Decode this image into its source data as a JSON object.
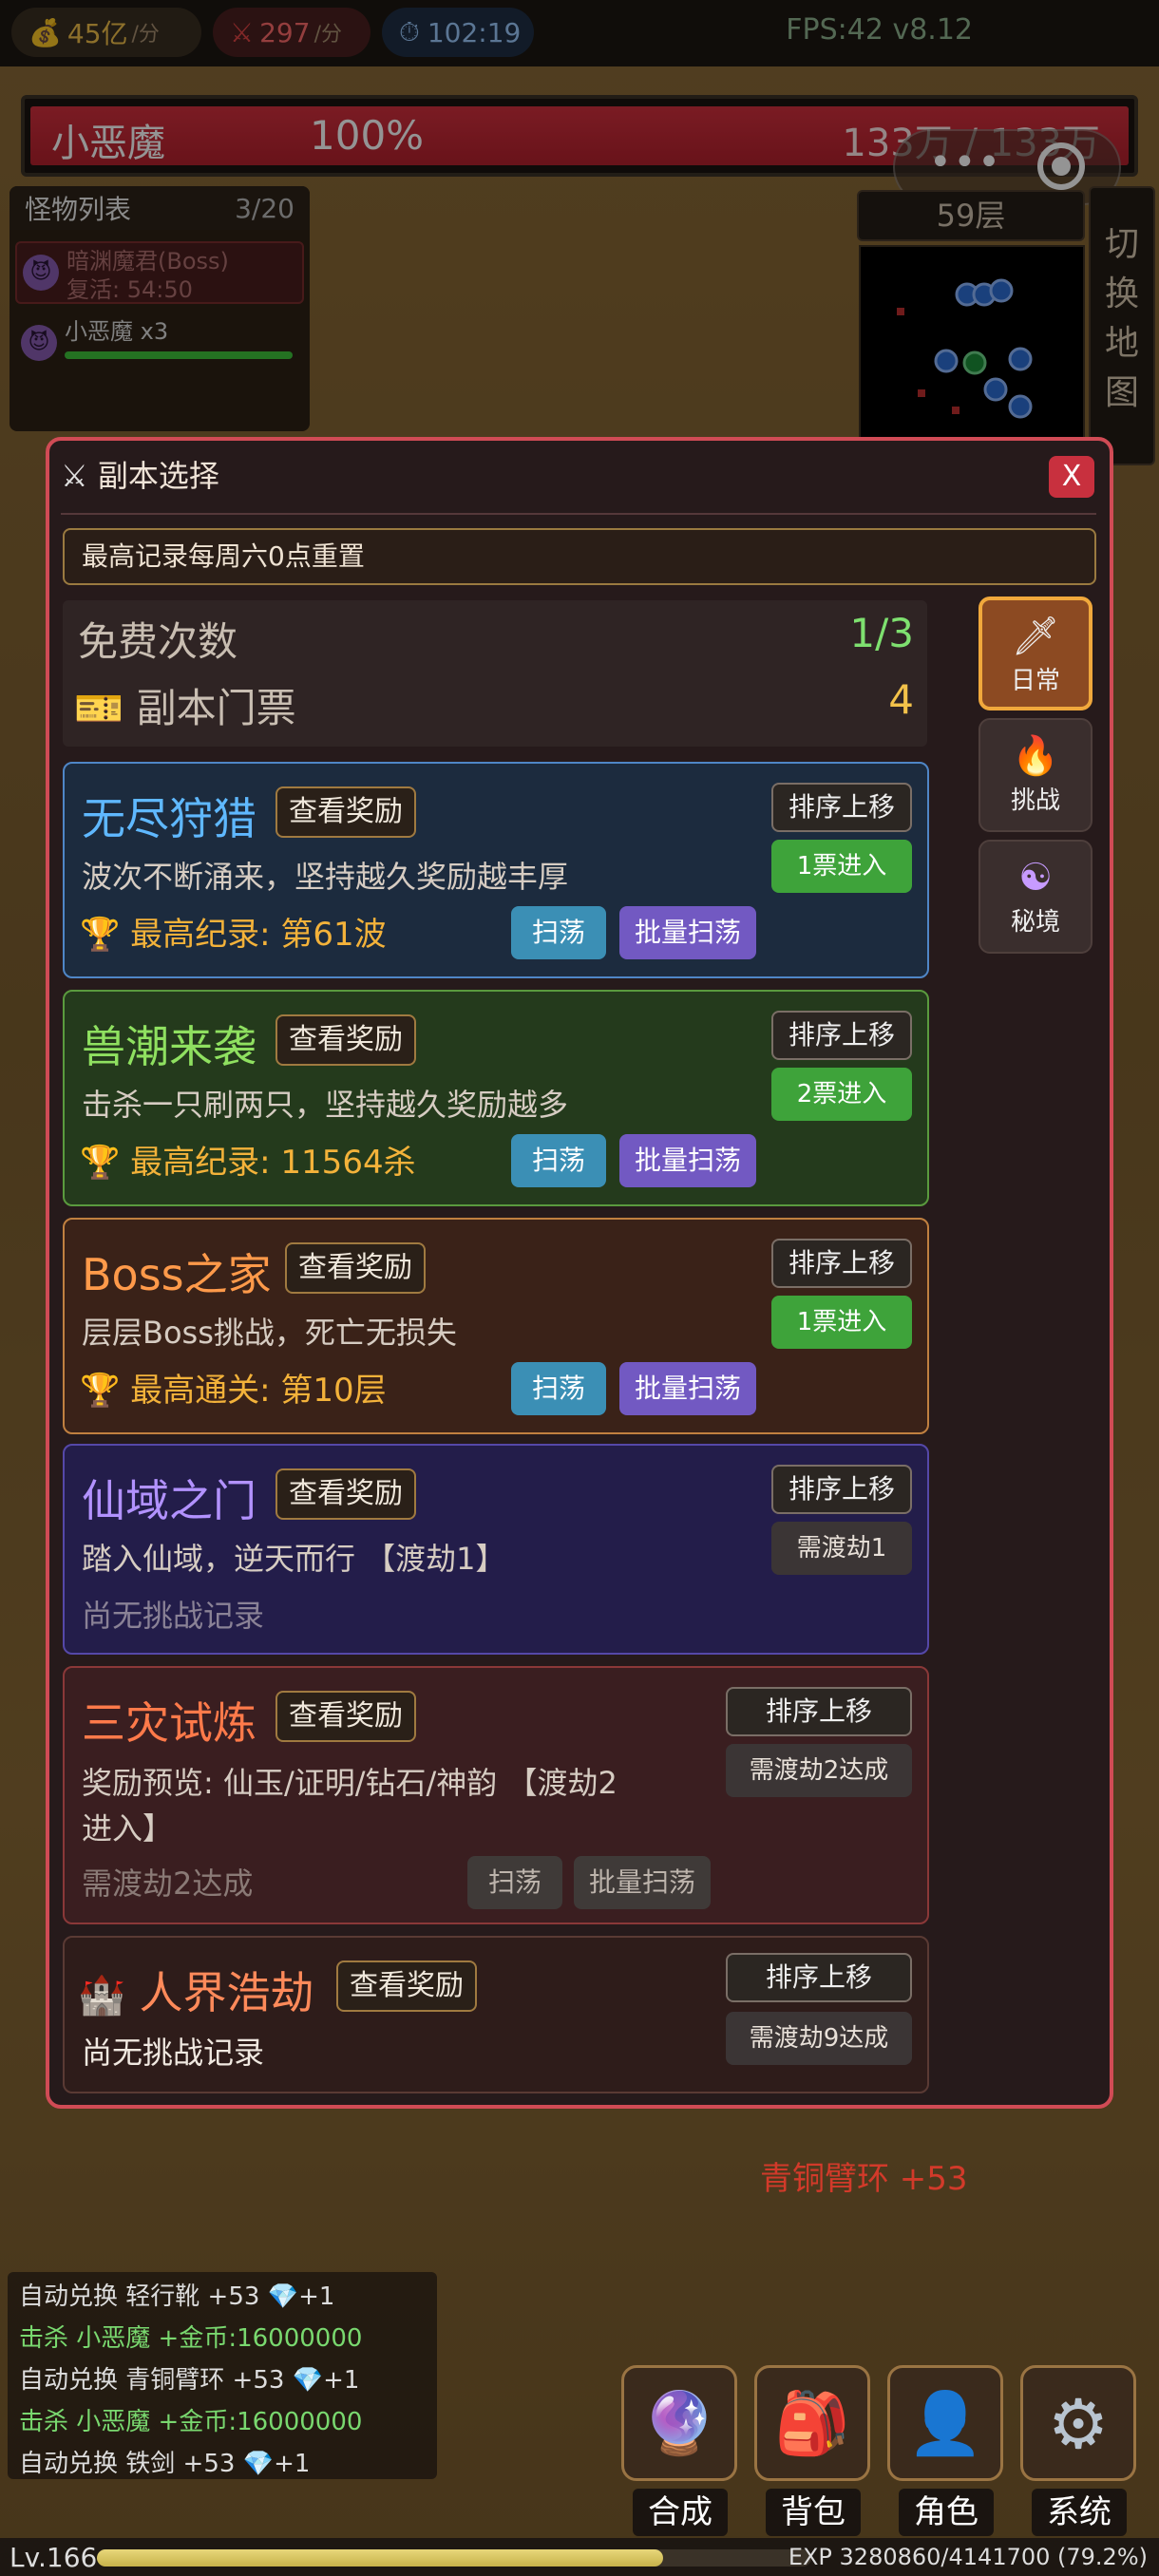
{
  "topbar": {
    "gold": "45亿",
    "gold_unit": "/分",
    "kills": "297",
    "kills_unit": "/分",
    "timer": "102:19",
    "fps": "FPS:42 v8.12"
  },
  "boss": {
    "name": "小恶魔",
    "percent": "100%",
    "hp": "133万 / 133万",
    "hp_fraction": 1.0
  },
  "monster_list": {
    "title": "怪物列表",
    "count": "3/20",
    "items": [
      {
        "name": "暗渊魔君(Boss)",
        "sub": "复活: 54:50"
      },
      {
        "name": "小恶魔 x3",
        "hp_fraction": 1.0
      }
    ]
  },
  "map": {
    "floor": "59层",
    "switch_label": "切换地图"
  },
  "modal": {
    "title": "副本选择",
    "close": "X",
    "notice": "最高记录每周六0点重置",
    "free_label": "免费次数",
    "free_value": "1/3",
    "ticket_label": "副本门票",
    "ticket_value": "4",
    "tabs": [
      {
        "label": "日常",
        "icon": "sword-icon",
        "active": true
      },
      {
        "label": "挑战",
        "icon": "fire-icon",
        "active": false
      },
      {
        "label": "秘境",
        "icon": "yin-yang-icon",
        "active": false
      }
    ],
    "cards": [
      {
        "title": "无尽狩猎",
        "reward": "查看奖励",
        "desc": "波次不断涌来，坚持越久奖励越丰厚",
        "record": "最高纪录: 第61波",
        "sort": "排序上移",
        "enter": "1票进入",
        "sweep": "扫荡",
        "batch": "批量扫荡"
      },
      {
        "title": "兽潮来袭",
        "reward": "查看奖励",
        "desc": "击杀一只刷两只，坚持越久奖励越多",
        "record": "最高纪录: 11564杀",
        "sort": "排序上移",
        "enter": "2票进入",
        "sweep": "扫荡",
        "batch": "批量扫荡"
      },
      {
        "title": "Boss之家",
        "reward": "查看奖励",
        "desc": "层层Boss挑战，死亡无损失",
        "record": "最高通关: 第10层",
        "sort": "排序上移",
        "enter": "1票进入",
        "sweep": "扫荡",
        "batch": "批量扫荡"
      },
      {
        "title": "仙域之门",
        "reward": "查看奖励",
        "desc": "踏入仙域，逆天而行 【渡劫1】",
        "record": "尚无挑战记录",
        "sort": "排序上移",
        "enter": "需渡劫1"
      },
      {
        "title": "三灾试炼",
        "reward": "查看奖励",
        "desc1": "奖励预览: 仙玉/证明/钻石/神韵 【渡劫2",
        "desc2": "进入】",
        "record": "需渡劫2达成",
        "sort": "排序上移",
        "enter": "需渡劫2达成",
        "sweep": "扫荡",
        "batch": "批量扫荡"
      },
      {
        "title": "人界浩劫",
        "reward": "查看奖励",
        "desc": "尚无挑战记录",
        "sort": "排序上移",
        "enter": "需渡劫9达成"
      }
    ]
  },
  "loot_float": "青铜臂环 +53",
  "logs": [
    {
      "prefix": "自动兑换",
      "text": " 轻行靴 +53 ",
      "gem": "+1"
    },
    {
      "prefix": "击杀",
      "text": " 小恶魔 +金币:16000000"
    },
    {
      "prefix": "自动兑换",
      "text": " 青铜臂环 +53 ",
      "gem": "+1"
    },
    {
      "prefix": "击杀",
      "text": " 小恶魔 +金币:16000000"
    },
    {
      "prefix": "自动兑换",
      "text": " 铁剑 +53 ",
      "gem": "+1"
    }
  ],
  "nav": [
    {
      "label": "合成",
      "icon": "crystal-ball-icon"
    },
    {
      "label": "背包",
      "icon": "backpack-icon"
    },
    {
      "label": "角色",
      "icon": "person-icon"
    },
    {
      "label": "系统",
      "icon": "gear-icon"
    }
  ],
  "footer": {
    "level": "Lv.166",
    "exp": "EXP 3280860/4141700 (79.2%)",
    "exp_fraction": 0.792
  },
  "colors": {
    "accent_red": "#d04b55",
    "green": "#3ea33a",
    "gold": "#f3b23a",
    "sweep_blue": "#3b8fb5",
    "batch_purple": "#7259c2"
  }
}
